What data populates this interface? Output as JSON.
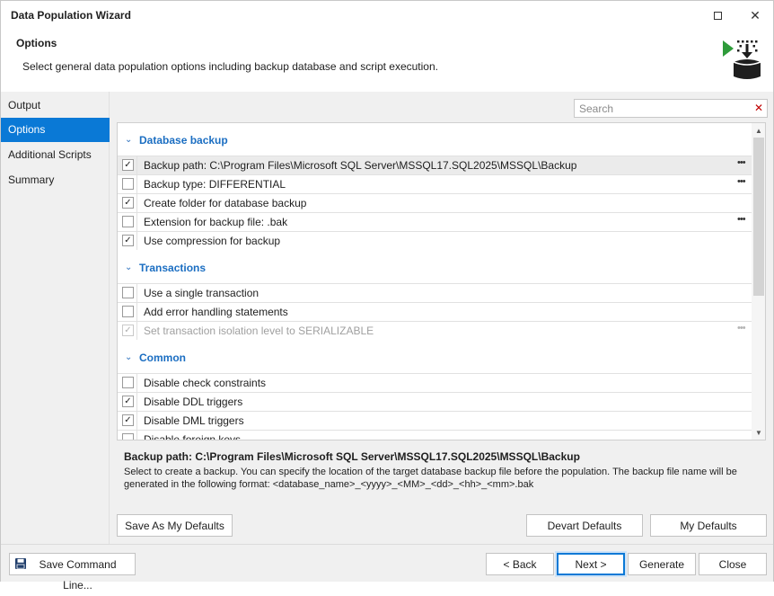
{
  "window": {
    "title": "Data Population Wizard"
  },
  "header": {
    "title": "Options",
    "description": "Select general data population options including backup database and script execution."
  },
  "sidebar": {
    "items": [
      {
        "label": "Output",
        "active": false
      },
      {
        "label": "Options",
        "active": true
      },
      {
        "label": "Additional Scripts",
        "active": false
      },
      {
        "label": "Summary",
        "active": false
      }
    ]
  },
  "search": {
    "placeholder": "Search",
    "value": ""
  },
  "options": {
    "groups": [
      {
        "label": "Database backup",
        "items": [
          {
            "label": "Backup path: C:\\Program Files\\Microsoft SQL Server\\MSSQL17.SQL2025\\MSSQL\\Backup",
            "checked": true,
            "more": true,
            "selected": true,
            "disabled": false
          },
          {
            "label": "Backup type: DIFFERENTIAL",
            "checked": false,
            "more": true,
            "selected": false,
            "disabled": false
          },
          {
            "label": "Create folder for database backup",
            "checked": true,
            "more": false,
            "selected": false,
            "disabled": false
          },
          {
            "label": "Extension for backup file: .bak",
            "checked": false,
            "more": true,
            "selected": false,
            "disabled": false
          },
          {
            "label": "Use compression for backup",
            "checked": true,
            "more": false,
            "selected": false,
            "disabled": false
          }
        ]
      },
      {
        "label": "Transactions",
        "items": [
          {
            "label": "Use a single transaction",
            "checked": false,
            "more": false,
            "selected": false,
            "disabled": false
          },
          {
            "label": "Add error handling statements",
            "checked": false,
            "more": false,
            "selected": false,
            "disabled": false
          },
          {
            "label": "Set transaction isolation level to SERIALIZABLE",
            "checked": true,
            "more": true,
            "selected": false,
            "disabled": true
          }
        ]
      },
      {
        "label": "Common",
        "items": [
          {
            "label": "Disable check constraints",
            "checked": false,
            "more": false,
            "selected": false,
            "disabled": false
          },
          {
            "label": "Disable DDL triggers",
            "checked": true,
            "more": false,
            "selected": false,
            "disabled": false
          },
          {
            "label": "Disable DML triggers",
            "checked": true,
            "more": false,
            "selected": false,
            "disabled": false
          },
          {
            "label": "Disable foreign keys",
            "checked": false,
            "more": false,
            "selected": false,
            "disabled": false
          }
        ]
      }
    ]
  },
  "description": {
    "title": "Backup path: C:\\Program Files\\Microsoft SQL Server\\MSSQL17.SQL2025\\MSSQL\\Backup",
    "text": "Select to create a backup. You can specify the location of the target database backup file before the population. The backup file name will be generated in the following format: <database_name>_<yyyy>_<MM>_<dd>_<hh>_<mm>.bak"
  },
  "buttons": {
    "save_as_defaults": "Save As My Defaults",
    "devart_defaults": "Devart Defaults",
    "my_defaults": "My Defaults",
    "save_command_line": "Save Command Line...",
    "back": "< Back",
    "next": "Next >",
    "generate": "Generate",
    "close": "Close"
  },
  "colors": {
    "accent": "#0a79d6",
    "group_label": "#1b6ec2",
    "icon_green": "#2e9b3a"
  },
  "icons": {
    "maximize": "maximize-icon",
    "close": "close-icon",
    "header": "database-populate-icon",
    "search_clear": "clear-icon",
    "save": "floppy-disk-icon"
  }
}
